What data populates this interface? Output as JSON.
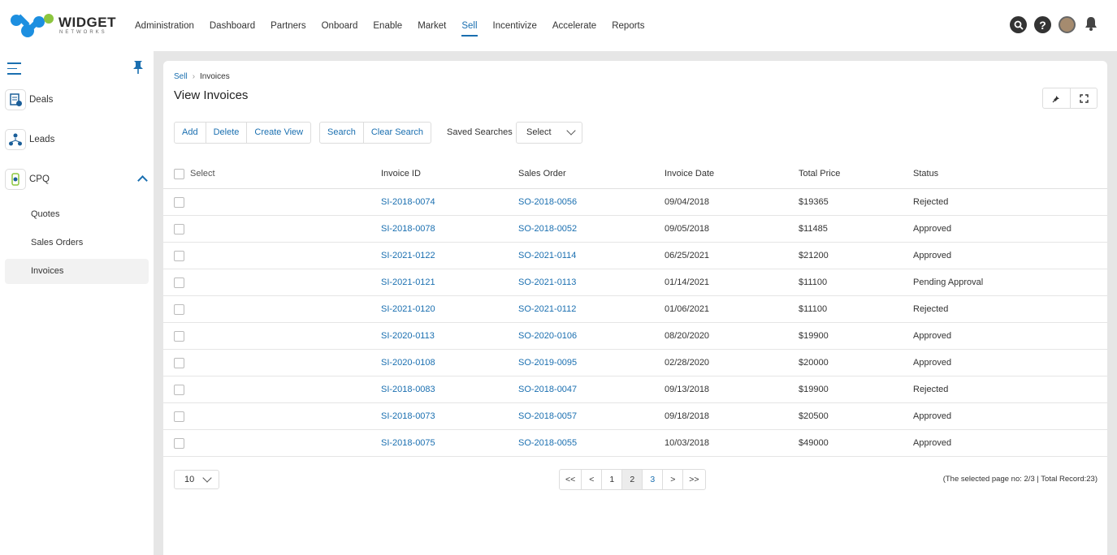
{
  "brand": {
    "name": "WIDGET",
    "tagline": "NETWORKS"
  },
  "nav": [
    "Administration",
    "Dashboard",
    "Partners",
    "Onboard",
    "Enable",
    "Market",
    "Sell",
    "Incentivize",
    "Accelerate",
    "Reports"
  ],
  "nav_active": "Sell",
  "colors": {
    "accent": "#1a6fb0",
    "logo_blue": "#1d8fe0",
    "logo_green": "#8cc63f"
  },
  "sidebar": {
    "items": [
      {
        "label": "Deals",
        "icon": "deals-icon"
      },
      {
        "label": "Leads",
        "icon": "leads-icon"
      },
      {
        "label": "CPQ",
        "icon": "cpq-icon"
      }
    ],
    "sub_items": [
      "Quotes",
      "Sales Orders",
      "Invoices"
    ]
  },
  "breadcrumb": {
    "parent": "Sell",
    "current": "Invoices"
  },
  "page_title": "View Invoices",
  "toolbar": {
    "add": "Add",
    "delete": "Delete",
    "create_view": "Create View",
    "search": "Search",
    "clear_search": "Clear Search",
    "saved_searches": "Saved Searches",
    "select": "Select"
  },
  "table": {
    "headers": {
      "select": "Select",
      "invoice_id": "Invoice ID",
      "sales_order": "Sales Order",
      "invoice_date": "Invoice Date",
      "total_price": "Total Price",
      "status": "Status"
    },
    "rows": [
      {
        "invoice_id": "SI-2018-0074",
        "sales_order": "SO-2018-0056",
        "date": "09/04/2018",
        "price": "$19365",
        "status": "Rejected"
      },
      {
        "invoice_id": "SI-2018-0078",
        "sales_order": "SO-2018-0052",
        "date": "09/05/2018",
        "price": "$11485",
        "status": "Approved"
      },
      {
        "invoice_id": "SI-2021-0122",
        "sales_order": "SO-2021-0114",
        "date": "06/25/2021",
        "price": "$21200",
        "status": "Approved"
      },
      {
        "invoice_id": "SI-2021-0121",
        "sales_order": "SO-2021-0113",
        "date": "01/14/2021",
        "price": "$11100",
        "status": "Pending Approval"
      },
      {
        "invoice_id": "SI-2021-0120",
        "sales_order": "SO-2021-0112",
        "date": "01/06/2021",
        "price": "$11100",
        "status": "Rejected"
      },
      {
        "invoice_id": "SI-2020-0113",
        "sales_order": "SO-2020-0106",
        "date": "08/20/2020",
        "price": "$19900",
        "status": "Approved"
      },
      {
        "invoice_id": "SI-2020-0108",
        "sales_order": "SO-2019-0095",
        "date": "02/28/2020",
        "price": "$20000",
        "status": "Approved"
      },
      {
        "invoice_id": "SI-2018-0083",
        "sales_order": "SO-2018-0047",
        "date": "09/13/2018",
        "price": "$19900",
        "status": "Rejected"
      },
      {
        "invoice_id": "SI-2018-0073",
        "sales_order": "SO-2018-0057",
        "date": "09/18/2018",
        "price": "$20500",
        "status": "Approved"
      },
      {
        "invoice_id": "SI-2018-0075",
        "sales_order": "SO-2018-0055",
        "date": "10/03/2018",
        "price": "$49000",
        "status": "Approved"
      }
    ]
  },
  "pagination": {
    "page_size": "10",
    "controls": [
      "<<",
      "<",
      "1",
      "2",
      "3",
      ">",
      ">>"
    ],
    "current": "2",
    "info": "(The selected page no: 2/3 | Total Record:23)"
  }
}
